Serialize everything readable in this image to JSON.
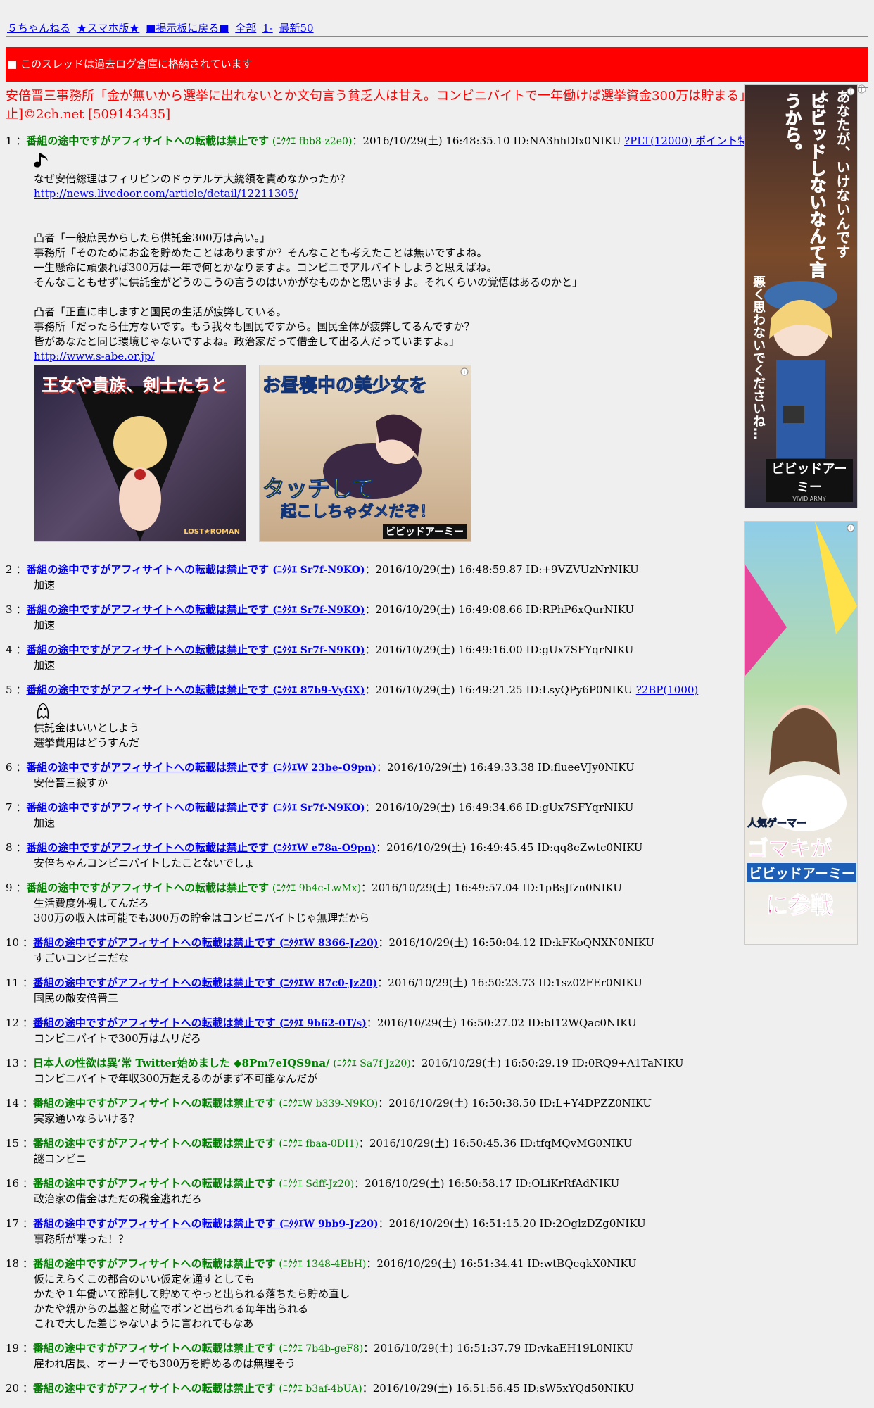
{
  "nav": {
    "site": "５ちゃんねる",
    "smartphone": "★スマホ版★",
    "back": "■掲示板に戻る■",
    "all": "全部",
    "range": "1-",
    "latest": "最新50"
  },
  "archived_notice": "■ このスレッドは過去ログ倉庫に格納されています",
  "thread_title": "安倍晋三事務所「金が無いから選挙に出れないとか文句言う貧乏人は甘え。コンビニバイトで一年働けば選挙資金300万は貯まる」 [無断転載禁止]©2ch.net [509143435]",
  "posts": [
    {
      "num": "1",
      "name": "番組の途中ですがアフィサイトへの転載は禁止です",
      "uid": "(ﾆｸｸｴ fbb8-z2e0)",
      "name_link": false,
      "meta": "：2016/10/29(土) 16:48:35.10 ID:NA3hhDlx0NIKU",
      "be": "?PLT(12000) ポイント特典",
      "icon": "music-note-icon",
      "lines": [
        "なぜ安倍総理はフィリピンのドゥテルテ大統領を責めなかったか？",
        {
          "link": "http://news.livedoor.com/article/detail/12211305/"
        },
        "",
        "",
        "凸者「一般庶民からしたら供託金300万は高い。」",
        "事務所「そのためにお金を貯めたことはありますか？そんなことも考えたことは無いですよね。",
        "一生懸命に頑張れば300万は一年で何とかなりますよ。コンビニでアルバイトしようと思えばね。",
        "そんなこともせずに供託金がどうのこうの言うのはいかがなものかと思いますよ。それくらいの覚悟はあるのかと」",
        "",
        "凸者「正直に申しますと国民の生活が疲弊している。",
        "事務所「だったら仕方ないです。もう我々も国民ですから。国民全体が疲弊してるんですか？",
        "皆があなたと同じ環境じゃないですよね。政治家だって借金して出る人だっていますよ。」",
        {
          "link": "http://www.s-abe.or.jp/"
        }
      ]
    },
    {
      "num": "2",
      "name": "番組の途中ですがアフィサイトへの転載は禁止です",
      "uid": "(ﾆｸｸｴ Sr7f-N9KO)",
      "name_link": true,
      "meta": "：2016/10/29(土) 16:48:59.87 ID:+9VZVUzNrNIKU",
      "lines": [
        "加速"
      ]
    },
    {
      "num": "3",
      "name": "番組の途中ですがアフィサイトへの転載は禁止です",
      "uid": "(ﾆｸｸｴ Sr7f-N9KO)",
      "name_link": true,
      "meta": "：2016/10/29(土) 16:49:08.66 ID:RPhP6xQurNIKU",
      "lines": [
        "加速"
      ]
    },
    {
      "num": "4",
      "name": "番組の途中ですがアフィサイトへの転載は禁止です",
      "uid": "(ﾆｸｸｴ Sr7f-N9KO)",
      "name_link": true,
      "meta": "：2016/10/29(土) 16:49:16.00 ID:gUx7SFYqrNIKU",
      "lines": [
        "加速"
      ]
    },
    {
      "num": "5",
      "name": "番組の途中ですがアフィサイトへの転載は禁止です",
      "uid": "(ﾆｸｸｴ 87b9-VyGX)",
      "name_link": true,
      "meta": "：2016/10/29(土) 16:49:21.25 ID:LsyQPy6P0NIKU",
      "be": "?2BP(1000)",
      "icon": "ghost-doodle-icon",
      "lines": [
        "供託金はいいとしよう",
        "選挙費用はどうすんだ"
      ]
    },
    {
      "num": "6",
      "name": "番組の途中ですがアフィサイトへの転載は禁止です",
      "uid": "(ﾆｸｸｴW 23be-O9pn)",
      "name_link": true,
      "meta": "：2016/10/29(土) 16:49:33.38 ID:flueeVJy0NIKU",
      "lines": [
        "安倍晋三殺すか"
      ]
    },
    {
      "num": "7",
      "name": "番組の途中ですがアフィサイトへの転載は禁止です",
      "uid": "(ﾆｸｸｴ Sr7f-N9KO)",
      "name_link": true,
      "meta": "：2016/10/29(土) 16:49:34.66 ID:gUx7SFYqrNIKU",
      "lines": [
        "加速"
      ]
    },
    {
      "num": "8",
      "name": "番組の途中ですがアフィサイトへの転載は禁止です",
      "uid": "(ﾆｸｸｴW e78a-O9pn)",
      "name_link": true,
      "meta": "：2016/10/29(土) 16:49:45.45 ID:qq8eZwtc0NIKU",
      "lines": [
        "安倍ちゃんコンビニバイトしたことないでしょ"
      ]
    },
    {
      "num": "9",
      "name": "番組の途中ですがアフィサイトへの転載は禁止です",
      "uid": "(ﾆｸｸｴ 9b4c-LwMx)",
      "name_link": false,
      "meta": "：2016/10/29(土) 16:49:57.04 ID:1pBsJfzn0NIKU",
      "lines": [
        "生活費度外視してんだろ",
        "300万の収入は可能でも300万の貯金はコンビニバイトじゃ無理だから"
      ]
    },
    {
      "num": "10",
      "name": "番組の途中ですがアフィサイトへの転載は禁止です",
      "uid": "(ﾆｸｸｴW 8366-Jz20)",
      "name_link": true,
      "meta": "：2016/10/29(土) 16:50:04.12 ID:kFKoQNXN0NIKU",
      "lines": [
        "すごいコンビニだな"
      ]
    },
    {
      "num": "11",
      "name": "番組の途中ですがアフィサイトへの転載は禁止です",
      "uid": "(ﾆｸｸｴW 87c0-Jz20)",
      "name_link": true,
      "meta": "：2016/10/29(土) 16:50:23.73 ID:1sz02FEr0NIKU",
      "lines": [
        "国民の敵安倍晋三"
      ]
    },
    {
      "num": "12",
      "name": "番組の途中ですがアフィサイトへの転載は禁止です",
      "uid": "(ﾆｸｸｴ 9b62-0T/s)",
      "name_link": true,
      "meta": "：2016/10/29(土) 16:50:27.02 ID:bI12WQac0NIKU",
      "lines": [
        "コンビニバイトで300万はムリだろ"
      ]
    },
    {
      "num": "13",
      "name": "日本人の性欲は異’常 Twitter始めました ◆8Pm7eIQS9na/",
      "uid": "(ﾆｸｸｴ Sa7f-Jz20)",
      "name_link": false,
      "meta": "：2016/10/29(土) 16:50:29.19 ID:0RQ9+A1TaNIKU",
      "lines": [
        "コンビニバイトで年収300万超えるのがまず不可能なんだが"
      ]
    },
    {
      "num": "14",
      "name": "番組の途中ですがアフィサイトへの転載は禁止です",
      "uid": "(ﾆｸｸｴW b339-N9KO)",
      "name_link": false,
      "meta": "：2016/10/29(土) 16:50:38.50 ID:L+Y4DPZZ0NIKU",
      "lines": [
        "実家通いならいける？"
      ]
    },
    {
      "num": "15",
      "name": "番組の途中ですがアフィサイトへの転載は禁止です",
      "uid": "(ﾆｸｸｴ fbaa-0DI1)",
      "name_link": false,
      "meta": "：2016/10/29(土) 16:50:45.36 ID:tfqMQvMG0NIKU",
      "lines": [
        "謎コンビニ"
      ]
    },
    {
      "num": "16",
      "name": "番組の途中ですがアフィサイトへの転載は禁止です",
      "uid": "(ﾆｸｸｴ Sdff-Jz20)",
      "name_link": false,
      "meta": "：2016/10/29(土) 16:50:58.17 ID:OLiKrRfAdNIKU",
      "lines": [
        "政治家の借金はただの税金逃れだろ"
      ]
    },
    {
      "num": "17",
      "name": "番組の途中ですがアフィサイトへの転載は禁止です",
      "uid": "(ﾆｸｸｴW 9bb9-Jz20)",
      "name_link": true,
      "meta": "：2016/10/29(土) 16:51:15.20 ID:2OglzDZg0NIKU",
      "lines": [
        "事務所が喋った！？"
      ]
    },
    {
      "num": "18",
      "name": "番組の途中ですがアフィサイトへの転載は禁止です",
      "uid": "(ﾆｸｸｴ 1348-4EbH)",
      "name_link": false,
      "meta": "：2016/10/29(土) 16:51:34.41 ID:wtBQegkX0NIKU",
      "lines": [
        "仮にえらくこの都合のいい仮定を通すとしても",
        "かたや１年働いて節制して貯めてやっと出られる落ちたら貯め直し",
        "かたや親からの基盤と財産でポンと出られる毎年出られる",
        "これで大した差じゃないように言われてもなあ"
      ]
    },
    {
      "num": "19",
      "name": "番組の途中ですがアフィサイトへの転載は禁止です",
      "uid": "(ﾆｸｸｴ 7b4b-geF8)",
      "name_link": false,
      "meta": "：2016/10/29(土) 16:51:37.79 ID:vkaEH19L0NIKU",
      "lines": [
        "雇われ店長、オーナーでも300万を貯めるのは無理そう"
      ]
    },
    {
      "num": "20",
      "name": "番組の途中ですがアフィサイトへの転載は禁止です",
      "uid": "(ﾆｸｸｴ b3af-4bUA)",
      "name_link": false,
      "meta": "：2016/10/29(土) 16:51:56.45 ID:sW5xYQd50NIKU",
      "lines": []
    }
  ],
  "ads": {
    "inline1": {
      "headline": "王女や貴族、剣士たちと",
      "logo": "LOST★ROMAN"
    },
    "inline2": {
      "headline1": "お昼寝中の美少女を",
      "headline2": "タッチして",
      "headline3": "起こしちゃダメだぞ！",
      "logo": "ビビッドアーミー"
    },
    "side1": {
      "text1": "あなたが、いけないんですよ…",
      "text2": "ビビッドしないなんて言うから。",
      "text3": "悪く思わないでくださいね…",
      "logo": "ビビッドアーミー",
      "logo_small": "VIVID ARMY"
    },
    "side2": {
      "tag": "人気ゲーマー",
      "big1": "ゴマキが",
      "big2": "ビビッドアーミー",
      "big3": "に参戦"
    }
  },
  "colors": {
    "link": "#0000ee",
    "name": "#008000",
    "title": "#ff0000",
    "banner": "#ff0000",
    "background": "#efefef"
  }
}
